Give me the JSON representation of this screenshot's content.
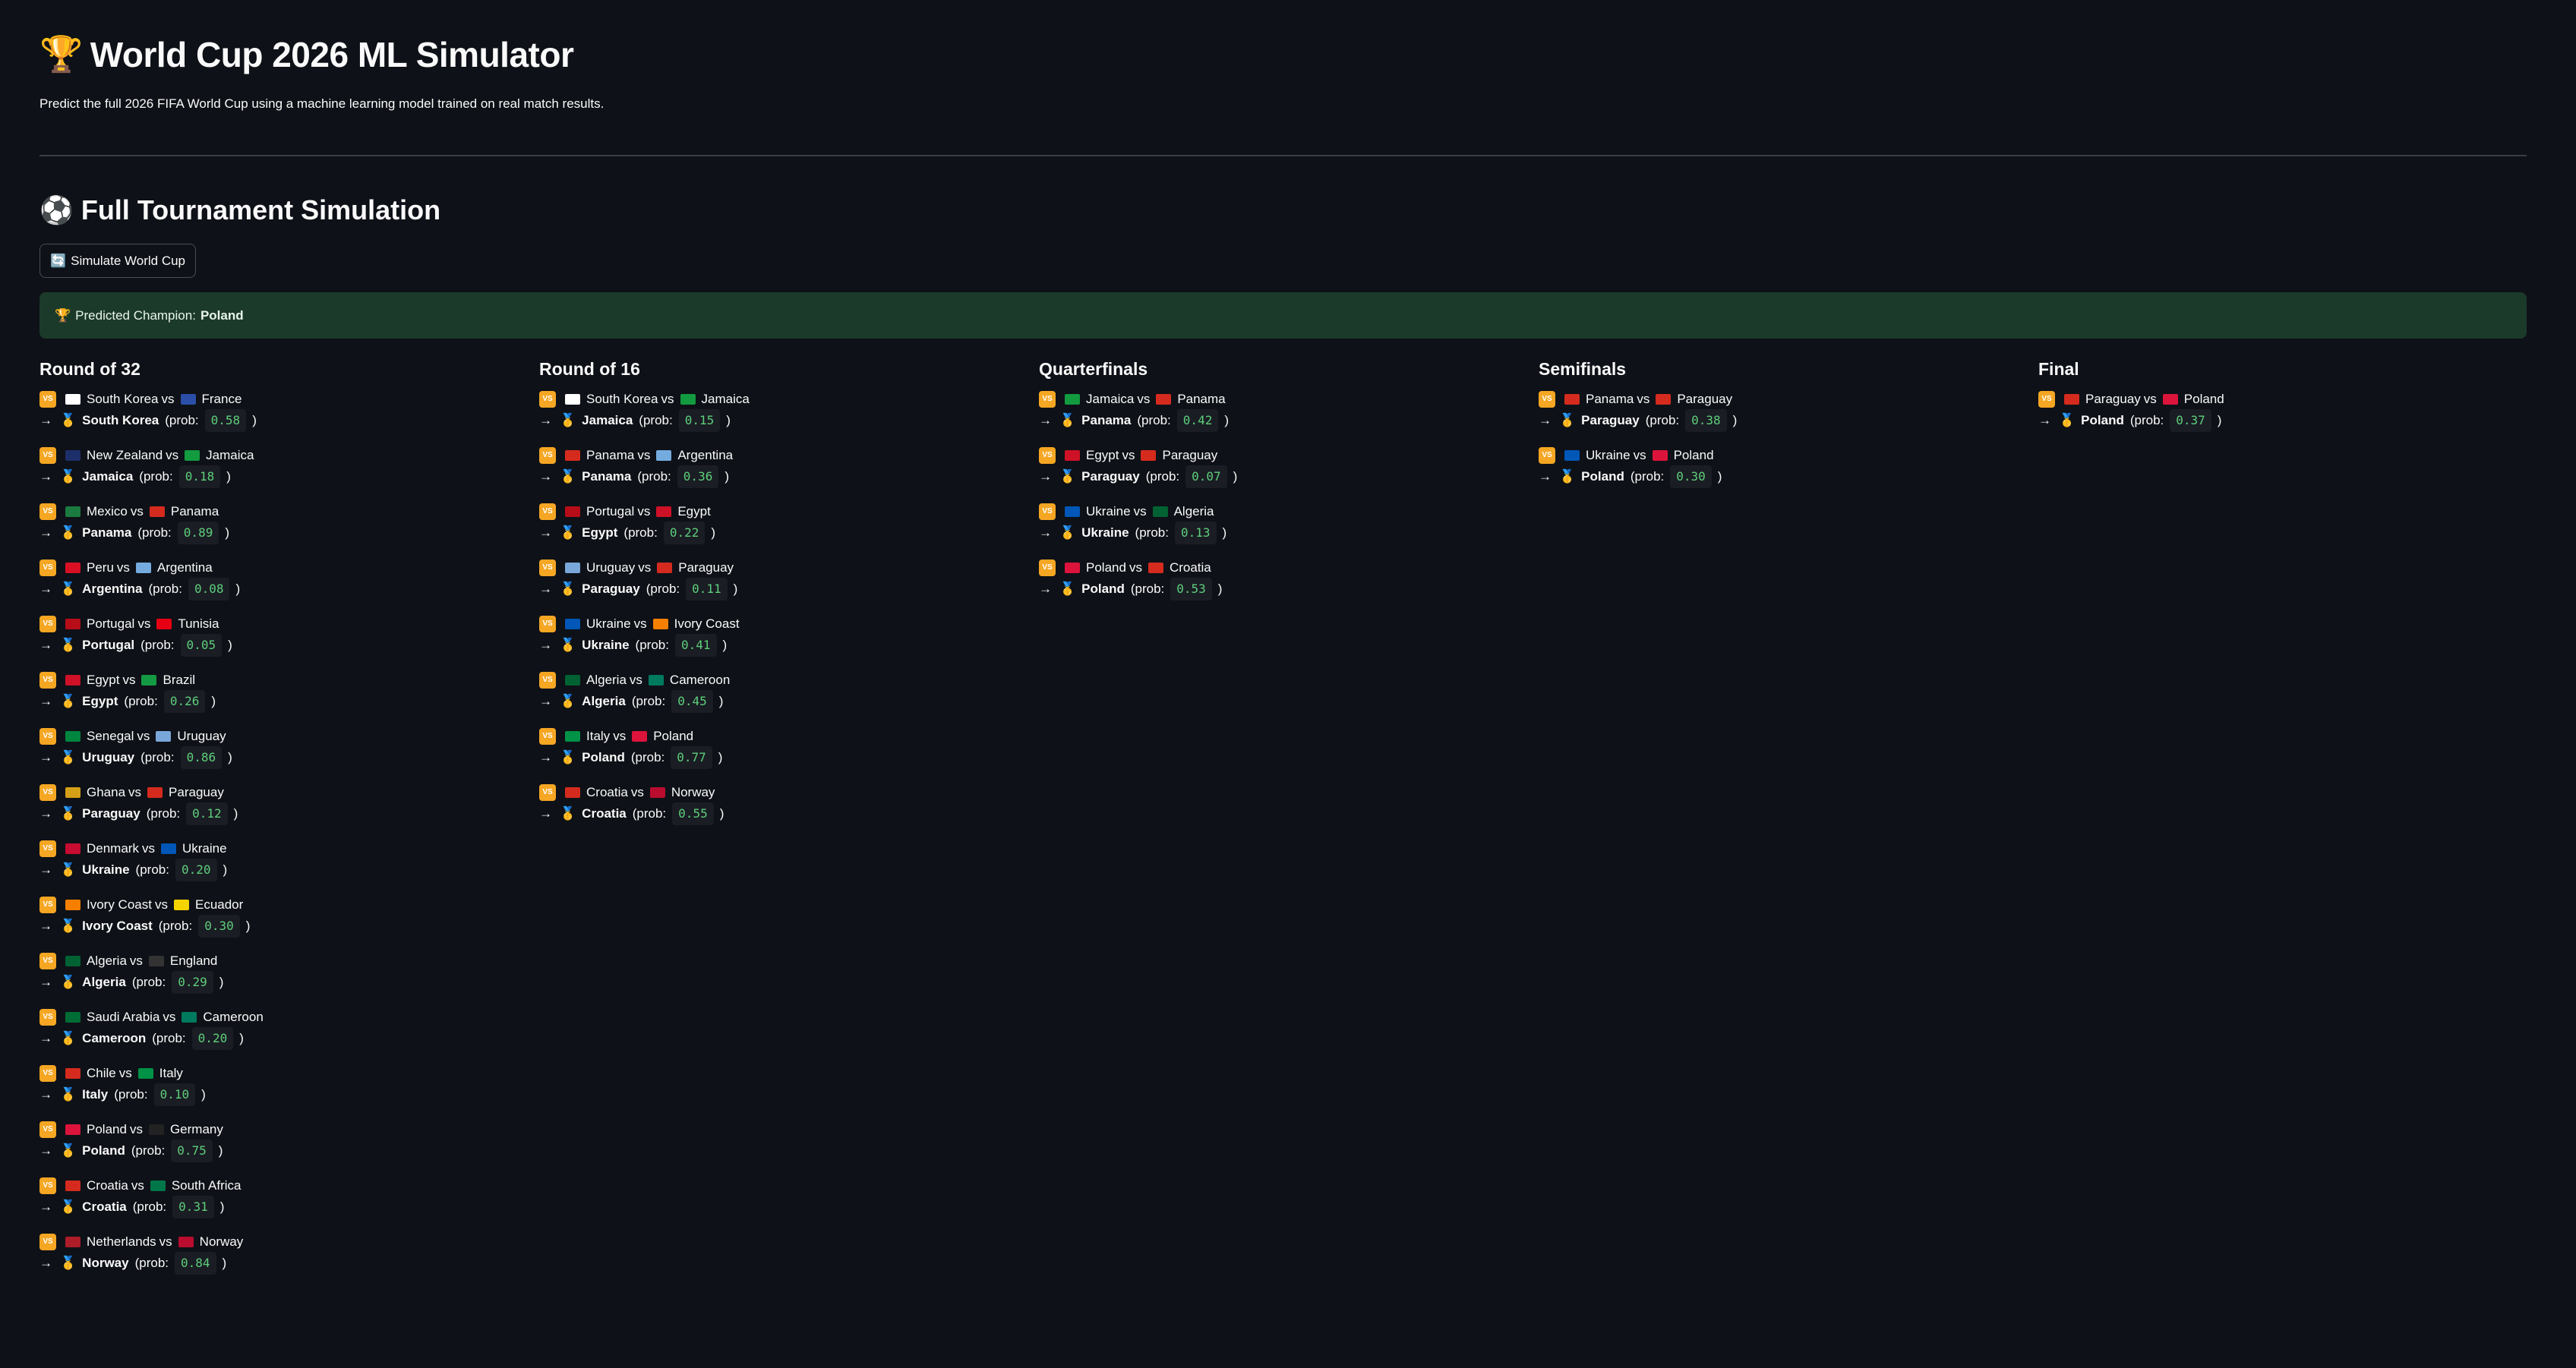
{
  "header": {
    "title_icon": "🏆",
    "title": "World Cup 2026 ML Simulator",
    "subtitle": "Predict the full 2026 FIFA World Cup using a machine learning model trained on real match results."
  },
  "simulation": {
    "section_icon": "⚽",
    "section_title": "Full Tournament Simulation",
    "button_icon": "🔄",
    "button_label": "Simulate World Cup",
    "champion_icon": "🏆",
    "champion_label": "Predicted Champion:",
    "champion": "Poland"
  },
  "labels": {
    "vs": "vs",
    "prob_prefix": "(prob:",
    "prob_suffix": ")",
    "arrow": "→",
    "medal": "🥇",
    "vs_badge": "VS"
  },
  "flag_colors": {
    "South Korea": "#ffffff",
    "France": "#2b4fa8",
    "New Zealand": "#1c2f6b",
    "Jamaica": "#129b3f",
    "Mexico": "#1a7a3f",
    "Panama": "#d52b1e",
    "Peru": "#d91023",
    "Argentina": "#74acdf",
    "Portugal": "#b70d19",
    "Tunisia": "#e70013",
    "Egypt": "#ce1126",
    "Brazil": "#139a43",
    "Senegal": "#00853f",
    "Uruguay": "#7aa7d9",
    "Ghana": "#d4a017",
    "Paraguay": "#d52b1e",
    "Denmark": "#c60c30",
    "Ukraine": "#0057b7",
    "Ivory Coast": "#f77f00",
    "Ecuador": "#f5d300",
    "Algeria": "#006233",
    "England": "#333333",
    "Saudi Arabia": "#006c35",
    "Cameroon": "#007a5e",
    "Chile": "#d52b1e",
    "Italy": "#009246",
    "Poland": "#dc143c",
    "Germany": "#222222",
    "Croatia": "#d52b1e",
    "South Africa": "#007749",
    "Netherlands": "#ae1c28",
    "Norway": "#ba0c2f"
  },
  "rounds": [
    {
      "title": "Round of 32",
      "matches": [
        {
          "home": "South Korea",
          "away": "France",
          "winner": "South Korea",
          "prob": "0.58"
        },
        {
          "home": "New Zealand",
          "away": "Jamaica",
          "winner": "Jamaica",
          "prob": "0.18"
        },
        {
          "home": "Mexico",
          "away": "Panama",
          "winner": "Panama",
          "prob": "0.89"
        },
        {
          "home": "Peru",
          "away": "Argentina",
          "winner": "Argentina",
          "prob": "0.08"
        },
        {
          "home": "Portugal",
          "away": "Tunisia",
          "winner": "Portugal",
          "prob": "0.05"
        },
        {
          "home": "Egypt",
          "away": "Brazil",
          "winner": "Egypt",
          "prob": "0.26"
        },
        {
          "home": "Senegal",
          "away": "Uruguay",
          "winner": "Uruguay",
          "prob": "0.86"
        },
        {
          "home": "Ghana",
          "away": "Paraguay",
          "winner": "Paraguay",
          "prob": "0.12"
        },
        {
          "home": "Denmark",
          "away": "Ukraine",
          "winner": "Ukraine",
          "prob": "0.20"
        },
        {
          "home": "Ivory Coast",
          "away": "Ecuador",
          "winner": "Ivory Coast",
          "prob": "0.30"
        },
        {
          "home": "Algeria",
          "away": "England",
          "winner": "Algeria",
          "prob": "0.29"
        },
        {
          "home": "Saudi Arabia",
          "away": "Cameroon",
          "winner": "Cameroon",
          "prob": "0.20"
        },
        {
          "home": "Chile",
          "away": "Italy",
          "winner": "Italy",
          "prob": "0.10"
        },
        {
          "home": "Poland",
          "away": "Germany",
          "winner": "Poland",
          "prob": "0.75"
        },
        {
          "home": "Croatia",
          "away": "South Africa",
          "winner": "Croatia",
          "prob": "0.31"
        },
        {
          "home": "Netherlands",
          "away": "Norway",
          "winner": "Norway",
          "prob": "0.84"
        }
      ]
    },
    {
      "title": "Round of 16",
      "matches": [
        {
          "home": "South Korea",
          "away": "Jamaica",
          "winner": "Jamaica",
          "prob": "0.15"
        },
        {
          "home": "Panama",
          "away": "Argentina",
          "winner": "Panama",
          "prob": "0.36"
        },
        {
          "home": "Portugal",
          "away": "Egypt",
          "winner": "Egypt",
          "prob": "0.22"
        },
        {
          "home": "Uruguay",
          "away": "Paraguay",
          "winner": "Paraguay",
          "prob": "0.11"
        },
        {
          "home": "Ukraine",
          "away": "Ivory Coast",
          "winner": "Ukraine",
          "prob": "0.41"
        },
        {
          "home": "Algeria",
          "away": "Cameroon",
          "winner": "Algeria",
          "prob": "0.45"
        },
        {
          "home": "Italy",
          "away": "Poland",
          "winner": "Poland",
          "prob": "0.77"
        },
        {
          "home": "Croatia",
          "away": "Norway",
          "winner": "Croatia",
          "prob": "0.55"
        }
      ]
    },
    {
      "title": "Quarterfinals",
      "matches": [
        {
          "home": "Jamaica",
          "away": "Panama",
          "winner": "Panama",
          "prob": "0.42"
        },
        {
          "home": "Egypt",
          "away": "Paraguay",
          "winner": "Paraguay",
          "prob": "0.07"
        },
        {
          "home": "Ukraine",
          "away": "Algeria",
          "winner": "Ukraine",
          "prob": "0.13"
        },
        {
          "home": "Poland",
          "away": "Croatia",
          "winner": "Poland",
          "prob": "0.53"
        }
      ]
    },
    {
      "title": "Semifinals",
      "matches": [
        {
          "home": "Panama",
          "away": "Paraguay",
          "winner": "Paraguay",
          "prob": "0.38"
        },
        {
          "home": "Ukraine",
          "away": "Poland",
          "winner": "Poland",
          "prob": "0.30"
        }
      ]
    },
    {
      "title": "Final",
      "matches": [
        {
          "home": "Paraguay",
          "away": "Poland",
          "winner": "Poland",
          "prob": "0.37"
        }
      ]
    }
  ]
}
